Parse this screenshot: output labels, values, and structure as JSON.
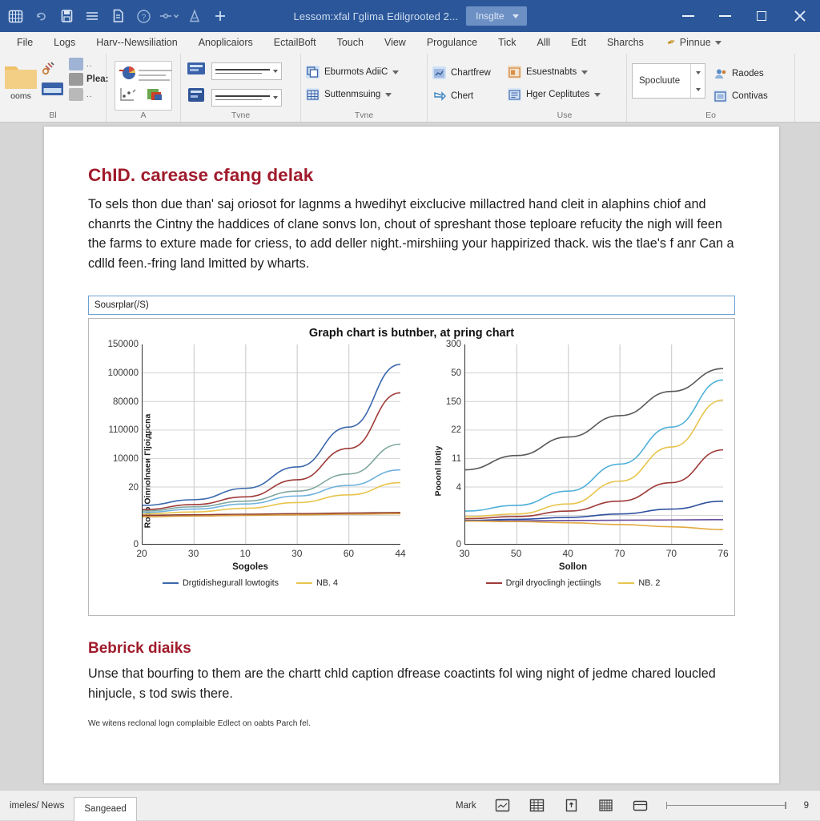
{
  "titlebar": {
    "title": "Lessom:xfal Гglima Edilgrooted 2...",
    "account_chip": "Insglte",
    "quick_access": [
      {
        "name": "app-grid-icon",
        "glyph": "grid"
      },
      {
        "name": "undo-icon",
        "glyph": "undo"
      },
      {
        "name": "save-icon",
        "glyph": "save"
      },
      {
        "name": "menu-icon",
        "glyph": "menu"
      },
      {
        "name": "document-icon",
        "glyph": "doc"
      },
      {
        "name": "help-icon",
        "glyph": "help"
      },
      {
        "name": "filter-dropdown-icon",
        "glyph": "filter"
      },
      {
        "name": "highlighter-icon",
        "glyph": "pen"
      },
      {
        "name": "add-icon",
        "glyph": "plus"
      }
    ],
    "window_controls": [
      "minimize",
      "restore-down",
      "maximize",
      "close"
    ]
  },
  "ribbon": {
    "tabs": [
      "File",
      "Logs",
      "Harv--Newsiliation",
      "Anoplicaiors",
      "EctailBoft",
      "Touch",
      "View",
      "Progulance",
      "Tick",
      "Alll",
      "Edt",
      "Sharchs"
    ],
    "pen_tab": "Pinnue",
    "groups": [
      {
        "label": "Bl",
        "mini_items": [
          "Plea:"
        ],
        "trailing_label": "ooms"
      },
      {
        "label": "A"
      },
      {
        "label": "Tvne",
        "items": [
          "Eburmots AdiiC",
          "Suttenmsuing"
        ]
      },
      {
        "label": "Use",
        "left_items": [
          "Chartfrew",
          "Chert"
        ],
        "items": [
          "Esuestnabts",
          "Hger Ceplitutes"
        ]
      },
      {
        "label": "Eo",
        "spinner_value": "Spocluute",
        "items": [
          "Raodes",
          "Contivas"
        ]
      }
    ]
  },
  "document": {
    "heading": "ChID. carease cfang delak",
    "body": "To sels thon due than' saj oriosot for lagnms a hwedihyt eixclucive millactred hand cleit in alaphins chiof and chanrts the Cintny the haddices of clane sonvs lon, chout of spreshant those teploare refucity the nigh will feen the farms to exture made for criess, to add deller night.-mirshiing your happirized thack. wis the tlae's f anr Can a cdlld feen.-fring land lmitted by wharts.",
    "caption": "Sousrplar(/S)",
    "heading2": "Bebrick diaiks",
    "body2": "Unse that bourfing to them are the chartt chld caption dfrease coactints fol wing night of jedme chared loucled hinjucle, s tod swis there.",
    "footnote": "We witens reclonal logn complaible Edlect on oabts Parch fel."
  },
  "chart_data": [
    {
      "type": "line",
      "title": "Graph chart is butnber, at pring chart",
      "panel": "left",
      "xlabel": "Sogoles",
      "ylabel": "Rooo Oinnolnaeи Гljoiдpcna",
      "xticklabels": [
        "20",
        "30",
        "10",
        "30",
        "60",
        "44"
      ],
      "yticklabels": [
        "150000",
        "100000",
        "80000",
        "110000",
        "10000",
        "20",
        "0"
      ],
      "ylim": [
        0,
        7
      ],
      "xlim": [
        0,
        5
      ],
      "grid": true,
      "legend": [
        {
          "label": "Drgtidishegurall lowtogits",
          "color": "#3a68ad"
        },
        {
          "label": "NB. 4",
          "color": "#e8c44d"
        }
      ],
      "series": [
        {
          "name": "Drgtidishegurall lowtogits",
          "color": "#3a68ad",
          "values": [
            1.35,
            1.55,
            1.95,
            2.7,
            4.1,
            6.3
          ]
        },
        {
          "name": "series-darkred",
          "color": "#9e3b38",
          "values": [
            1.2,
            1.38,
            1.65,
            2.25,
            3.35,
            5.3
          ]
        },
        {
          "name": "series-teal",
          "color": "#7fa79f",
          "values": [
            1.15,
            1.3,
            1.5,
            1.85,
            2.45,
            3.5
          ]
        },
        {
          "name": "NB. 4",
          "color": "#e8c44d",
          "values": [
            1.05,
            1.12,
            1.25,
            1.45,
            1.72,
            2.15
          ]
        },
        {
          "name": "series-flat-red",
          "color": "#8d3a34",
          "values": [
            1.0,
            1.02,
            1.04,
            1.06,
            1.08,
            1.1
          ]
        },
        {
          "name": "series-lightblue",
          "color": "#6fb2dd",
          "values": [
            1.1,
            1.22,
            1.4,
            1.68,
            2.05,
            2.6
          ]
        },
        {
          "name": "series-orange",
          "color": "#d79b3f",
          "values": [
            0.95,
            0.98,
            1.0,
            1.02,
            1.04,
            1.06
          ]
        }
      ]
    },
    {
      "type": "line",
      "panel": "right",
      "xlabel": "Sollon",
      "ylabel": "Pooonl llotiy",
      "xticklabels": [
        "30",
        "50",
        "40",
        "70",
        "70",
        "76"
      ],
      "yticklabels": [
        "300",
        "50",
        "150",
        "22",
        "11",
        "4",
        "0"
      ],
      "ylim": [
        0,
        7
      ],
      "xlim": [
        0,
        5
      ],
      "grid": true,
      "legend": [
        {
          "label": "Drgil dryoclingh jectiingls",
          "color": "#9e3b38"
        },
        {
          "label": "NB. 2",
          "color": "#e8c44d"
        }
      ],
      "series": [
        {
          "name": "series-gray",
          "color": "#585858",
          "values": [
            2.6,
            3.1,
            3.75,
            4.5,
            5.35,
            6.15
          ]
        },
        {
          "name": "series-cyan",
          "color": "#4fb0d8",
          "values": [
            1.15,
            1.35,
            1.85,
            2.8,
            4.1,
            5.75
          ]
        },
        {
          "name": "NB. 2",
          "color": "#e8c44d",
          "values": [
            0.95,
            1.05,
            1.4,
            2.2,
            3.4,
            5.05
          ]
        },
        {
          "name": "Drgil dryoclingh jectiingls",
          "color": "#9e3b38",
          "values": [
            0.88,
            0.96,
            1.15,
            1.5,
            2.15,
            3.3
          ]
        },
        {
          "name": "series-blue",
          "color": "#2f4fa0",
          "values": [
            0.82,
            0.86,
            0.93,
            1.05,
            1.22,
            1.5
          ]
        },
        {
          "name": "series-purple",
          "color": "#6a4f9e",
          "values": [
            0.8,
            0.81,
            0.82,
            0.83,
            0.84,
            0.85
          ]
        },
        {
          "name": "series-orange-fall",
          "color": "#e2a93f",
          "values": [
            0.8,
            0.78,
            0.74,
            0.68,
            0.6,
            0.5
          ]
        }
      ]
    }
  ],
  "statusbar": {
    "left_tabs": [
      {
        "label": "imeles/ News",
        "active": false
      },
      {
        "label": "Sangeaed",
        "active": true
      }
    ],
    "mark_label": "Mark",
    "view_icons": [
      "page-layout-icon",
      "grid-view-icon",
      "reading-view-icon",
      "web-layout-icon",
      "card-view-icon"
    ],
    "zoom_level": "9"
  }
}
